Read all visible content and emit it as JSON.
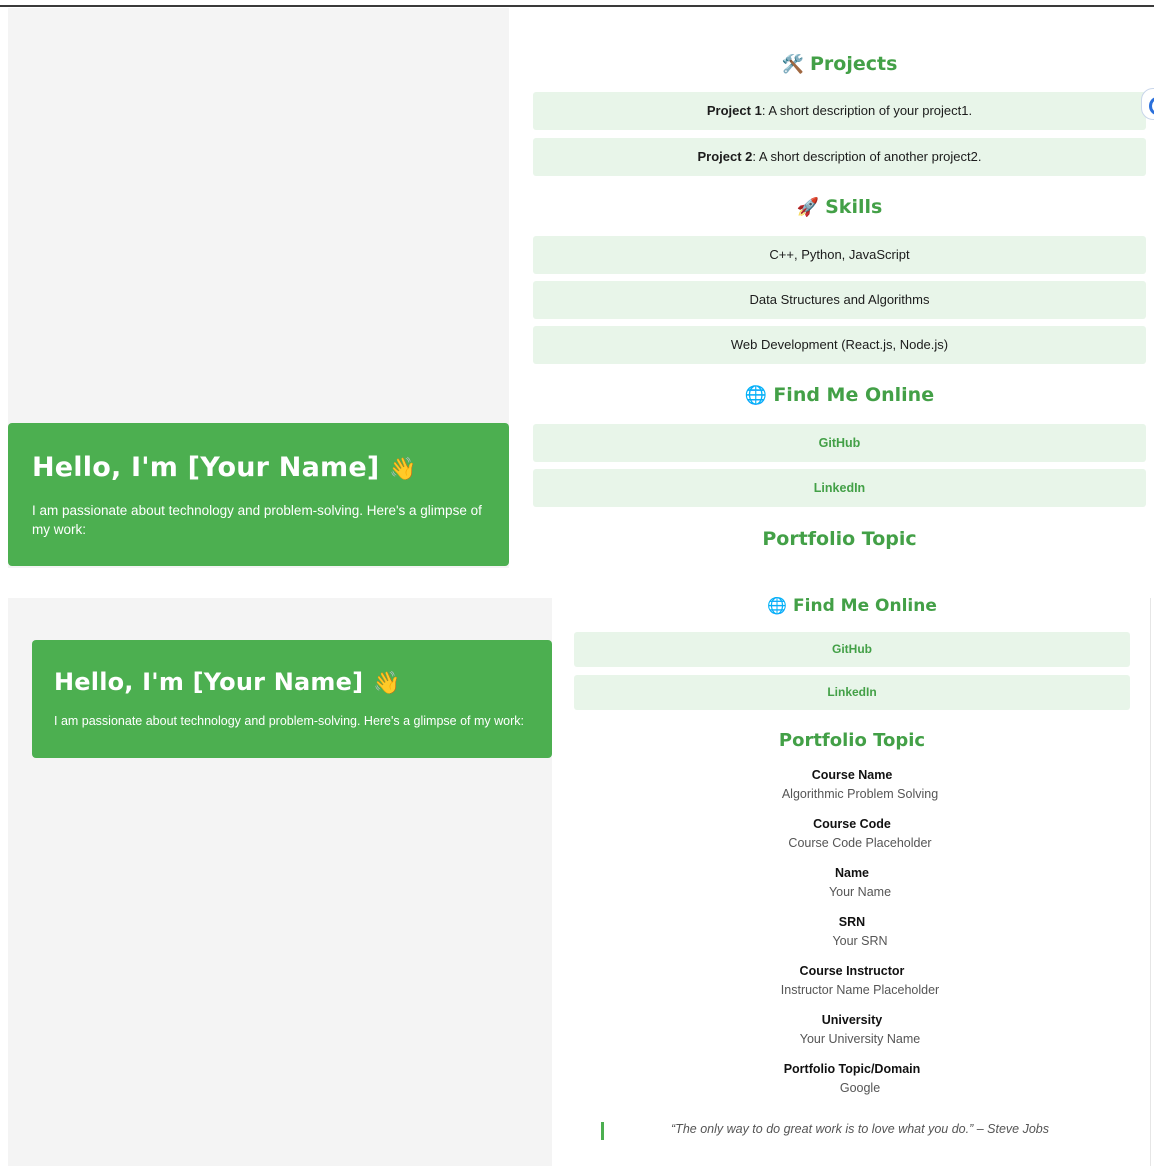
{
  "hero": {
    "greeting": "Hello, I'm [Your Name]",
    "wave_icon": "👋",
    "intro": "I am passionate about technology and problem-solving. Here's a glimpse of my work:"
  },
  "projects": {
    "icon": "🛠️",
    "title": "Projects",
    "items": [
      {
        "name": "Project 1",
        "desc": ": A short description of your project1."
      },
      {
        "name": "Project 2",
        "desc": ": A short description of another project2."
      }
    ]
  },
  "skills": {
    "icon": "🚀",
    "title": "Skills",
    "items": [
      "C++, Python, JavaScript",
      "Data Structures and Algorithms",
      "Web Development (React.js, Node.js)"
    ]
  },
  "online": {
    "icon": "🌐",
    "title": "Find Me Online",
    "links": [
      "GitHub",
      "LinkedIn"
    ]
  },
  "portfolio": {
    "title": "Portfolio Topic",
    "fields": [
      {
        "label": "Course Name",
        "value": "Algorithmic Problem Solving"
      },
      {
        "label": "Course Code",
        "value": "Course Code Placeholder"
      },
      {
        "label": "Name",
        "value": "Your Name"
      },
      {
        "label": "SRN",
        "value": "Your SRN"
      },
      {
        "label": "Course Instructor",
        "value": "Instructor Name Placeholder"
      },
      {
        "label": "University",
        "value": "Your University Name"
      },
      {
        "label": "Portfolio Topic/Domain",
        "value": "Google"
      }
    ]
  },
  "quote": "“The only way to do great work is to love what you do.” – Steve Jobs",
  "colors": {
    "accent": "#4caf50",
    "card_bg": "#e8f5e9",
    "pane_bg": "#f4f4f4"
  }
}
